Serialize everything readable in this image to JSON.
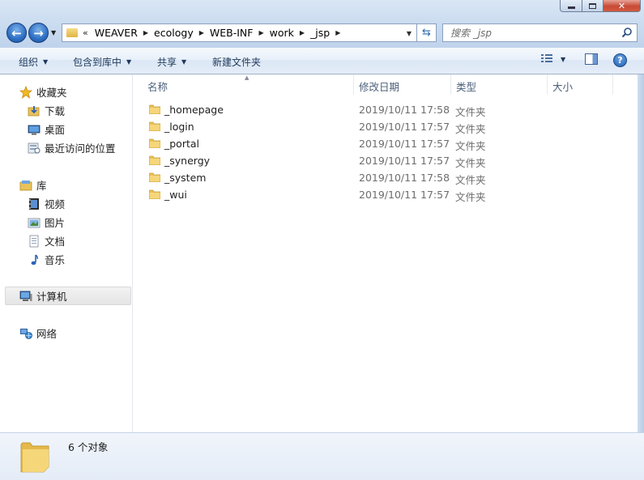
{
  "window": {
    "caption": {
      "minimize": "—",
      "maximize": "☐",
      "close": "✕"
    }
  },
  "nav": {
    "back_icon": "back-arrow-icon",
    "forward_icon": "forward-arrow-icon"
  },
  "address": {
    "more": "«",
    "crumbs": [
      "WEAVER",
      "ecology",
      "WEB-INF",
      "work",
      "_jsp"
    ]
  },
  "search": {
    "placeholder": "搜索 _jsp"
  },
  "toolbar": {
    "organize": "组织",
    "include_in_library": "包含到库中",
    "share": "共享",
    "new_folder": "新建文件夹"
  },
  "sidebar": {
    "favorites": {
      "label": "收藏夹",
      "items": [
        {
          "label": "下载",
          "icon": "downloads-icon"
        },
        {
          "label": "桌面",
          "icon": "desktop-icon"
        },
        {
          "label": "最近访问的位置",
          "icon": "recent-places-icon"
        }
      ]
    },
    "libraries": {
      "label": "库",
      "items": [
        {
          "label": "视频",
          "icon": "videos-icon"
        },
        {
          "label": "图片",
          "icon": "pictures-icon"
        },
        {
          "label": "文档",
          "icon": "documents-icon"
        },
        {
          "label": "音乐",
          "icon": "music-icon"
        }
      ]
    },
    "computer": {
      "label": "计算机"
    },
    "network": {
      "label": "网络"
    }
  },
  "columns": {
    "name": "名称",
    "modified": "修改日期",
    "type": "类型",
    "size": "大小"
  },
  "files": [
    {
      "name": "_homepage",
      "modified": "2019/10/11 17:58",
      "type": "文件夹"
    },
    {
      "name": "_login",
      "modified": "2019/10/11 17:57",
      "type": "文件夹"
    },
    {
      "name": "_portal",
      "modified": "2019/10/11 17:57",
      "type": "文件夹"
    },
    {
      "name": "_synergy",
      "modified": "2019/10/11 17:57",
      "type": "文件夹"
    },
    {
      "name": "_system",
      "modified": "2019/10/11 17:58",
      "type": "文件夹"
    },
    {
      "name": "_wui",
      "modified": "2019/10/11 17:57",
      "type": "文件夹"
    }
  ],
  "status": {
    "count": "6 个对象"
  },
  "colors": {
    "folder": "#e9c25a",
    "accent": "#1e395b"
  }
}
